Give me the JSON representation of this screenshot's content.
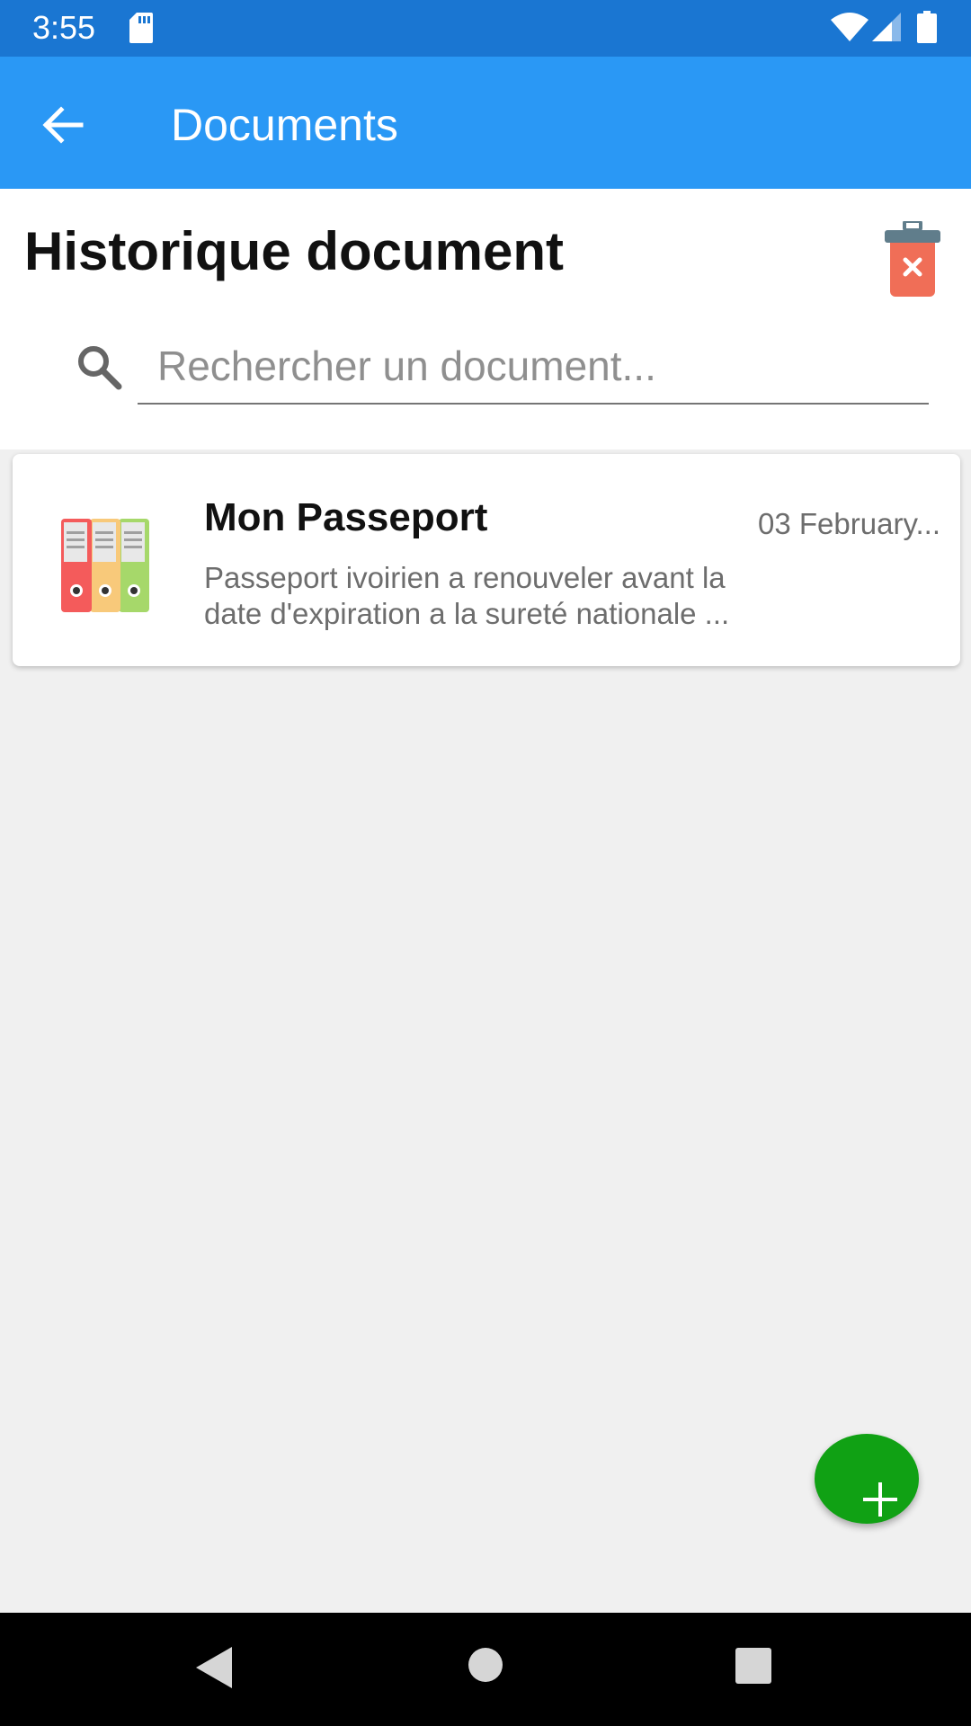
{
  "status_bar": {
    "time": "3:55",
    "icons": [
      "sd-card-icon",
      "wifi-icon",
      "cell-signal-icon",
      "battery-icon"
    ]
  },
  "app_bar": {
    "title": "Documents",
    "back_icon": "arrow-left-icon",
    "color": "#2a98f5"
  },
  "header": {
    "title": "Historique document",
    "trash_icon": "trash-delete-icon",
    "trash_color": "#f06e57"
  },
  "search": {
    "value": "",
    "placeholder": "Rechercher un document...",
    "icon": "search-icon"
  },
  "documents": [
    {
      "title": "Mon Passeport",
      "date": "03 February...",
      "description": "Passeport ivoirien a renouveler avant la date d'expiration a la sureté nationale ...",
      "icon": "binders-icon"
    }
  ],
  "fab": {
    "icon": "plus-icon",
    "color": "#10a114"
  },
  "nav_bar": {
    "icons": [
      "nav-back-icon",
      "nav-home-icon",
      "nav-recents-icon"
    ]
  }
}
